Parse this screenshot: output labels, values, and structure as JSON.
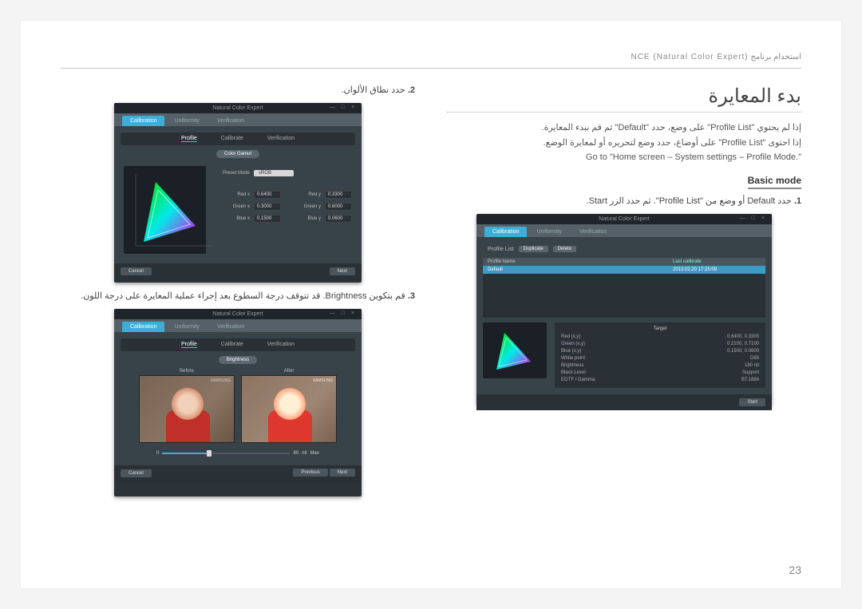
{
  "header": "استخدام برنامج NCE (Natural Color Expert)",
  "page_number": "23",
  "right": {
    "title": "بدء المعايرة",
    "para1": "إذا لم يحتوي \"Profile List\" على وضع، حدد \"Default\" ثم قم ببدء المعايرة.",
    "para2": "إذا احتوى \"Profile List\" على أوضاع، حدد وضع لتحريره أو لمعايرة الوضع.",
    "para3": "Go to \"Home screen – System settings – Profile Mode.\"",
    "basic_mode": "Basic mode",
    "step1_num": "1.",
    "step1_text": "حدد Default أو وضع من \"Profile List\". ثم حدد الزر Start."
  },
  "left": {
    "step2_num": "2.",
    "step2_text": "حدد نطاق الألوان.",
    "step3_num": "3.",
    "step3_text": "قم بتكوين Brightness. قد تتوقف درجة السطوع بعد إجراء عملية المعايرة على درجة اللون."
  },
  "app_common": {
    "title": "Natural Color Expert",
    "tab_cal": "Calibration",
    "tab_uni": "Uniformity",
    "tab_ver": "Verification",
    "btn_cancel": "Cancel",
    "btn_next": "Next",
    "btn_start": "Start",
    "btn_previous": "Previous"
  },
  "app1": {
    "profile_list": "Profile List",
    "btn1": "Duplicate",
    "btn2": "Delete",
    "col_name": "Profile Name",
    "col_date": "Last calibrate",
    "row_name": "Default",
    "row_date": "2013.02.20   17:25:09",
    "target": {
      "head": "Target",
      "r1k": "Red (x,y)",
      "r1v": "0.6400, 0.3300",
      "r2k": "Green (x,y)",
      "r2v": "0.2100, 0.7100",
      "r3k": "Blue (x,y)",
      "r3v": "0.1500, 0.0600",
      "r4k": "White point",
      "r4v": "D65",
      "r5k": "Brightness",
      "r5v": "180 nit",
      "r6k": "Black Level",
      "r6v": "Support",
      "r7k": "EOTF / Gamma",
      "r7v": "BT.1886"
    }
  },
  "app2": {
    "sub_profile": "Profile",
    "sub_cal": "Calibrate",
    "sub_ver": "Verification",
    "pill": "Color Gamut",
    "preset": "Preset Mode",
    "preset_val": "sRGB",
    "red": "Red x",
    "red_v": "0.6400",
    "redy": "Red y",
    "redy_v": "0.3300",
    "green": "Green x",
    "green_v": "0.3000",
    "greeny": "Green y",
    "greeny_v": "0.6000",
    "blue": "Blue x",
    "blue_v": "0.1500",
    "bluey": "Blue y",
    "bluey_v": "0.0600"
  },
  "app3": {
    "pill": "Brightness",
    "before": "Before",
    "after": "After",
    "val": "80",
    "unit": "nit",
    "max": "Max"
  }
}
